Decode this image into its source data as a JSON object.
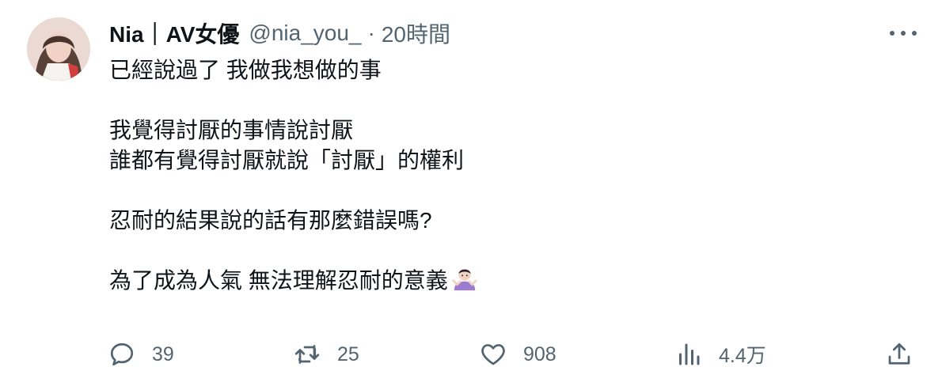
{
  "tweet": {
    "author_name": "Nia｜AV女優",
    "handle": "@nia_you_",
    "separator": "·",
    "time": "20時間",
    "lines": [
      "已經說過了 我做我想做的事",
      "",
      "我覺得討厭的事情說討厭",
      "誰都有覺得討厭就說「討厭」的權利",
      "",
      "忍耐的結果說的話有那麼錯誤嗎?",
      "",
      "為了成為人氣 無法理解忍耐的意義"
    ]
  },
  "actions": {
    "reply_count": "39",
    "retweet_count": "25",
    "like_count": "908",
    "views_count": "4.4万"
  },
  "icons": {
    "reply": "reply-icon",
    "retweet": "retweet-icon",
    "like": "heart-icon",
    "views": "views-icon",
    "share": "share-icon",
    "more": "more-icon",
    "emoji": "person-shrugging-emoji"
  },
  "colors": {
    "text": "#0f1419",
    "secondary": "#536471",
    "emoji": "#9b7ccf"
  }
}
